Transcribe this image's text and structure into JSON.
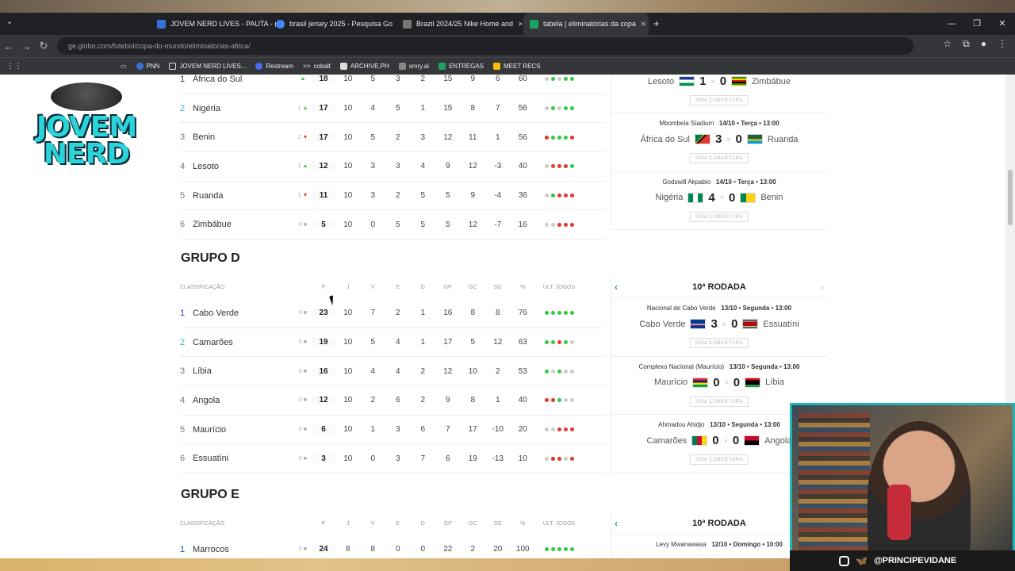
{
  "browser": {
    "tabs": [
      {
        "title": "JOVEM NERD LIVES - PAUTA - (",
        "color": "#3b6fd8"
      },
      {
        "title": "brasil jersey 2025 - Pesquisa Go",
        "color": "#4285f4"
      },
      {
        "title": "Brazil 2024/25 Nike Home and",
        "color": "#777777"
      },
      {
        "title": "tabela | eliminatórias da copa",
        "color": "#1aa260"
      }
    ],
    "url": "ge.globo.com/futebol/copa-do-mundo/eliminatorias-africa/",
    "bookmarks": [
      "PNN",
      "JOVEM NERD LIVES...",
      "Restream",
      "cobalt",
      "ARCHIVE.PH",
      "smry.ai",
      "ENTREGAS",
      "MEET RECS"
    ]
  },
  "logo": {
    "text": "JOVEM NERD"
  },
  "groupC": {
    "partial_row": {
      "pos": "1",
      "name": "África do Sul",
      "pts": "18",
      "j": "10",
      "v": "5",
      "e": "3",
      "d": "2",
      "gp": "15",
      "gc": "9",
      "sg": "6",
      "pct": "60"
    },
    "rows": [
      {
        "pos": "2",
        "name": "Nigéria",
        "trend": "1",
        "pts": "17",
        "j": "10",
        "v": "4",
        "e": "5",
        "d": "1",
        "gp": "15",
        "gc": "8",
        "sg": "7",
        "pct": "56",
        "form": [
          "#ccc",
          "#2ecc40",
          "#ccc",
          "#2ecc40",
          "#2ecc40"
        ]
      },
      {
        "pos": "3",
        "name": "Benin",
        "trend": "2",
        "pts": "17",
        "j": "10",
        "v": "5",
        "e": "2",
        "d": "3",
        "gp": "12",
        "gc": "11",
        "sg": "1",
        "pct": "56",
        "form": [
          "#e3342f",
          "#2ecc40",
          "#2ecc40",
          "#2ecc40",
          "#e3342f"
        ]
      },
      {
        "pos": "4",
        "name": "Lesoto",
        "trend": "1",
        "pts": "12",
        "j": "10",
        "v": "3",
        "e": "3",
        "d": "4",
        "gp": "9",
        "gc": "12",
        "sg": "-3",
        "pct": "40",
        "form": [
          "#ccc",
          "#e3342f",
          "#e3342f",
          "#e3342f",
          "#2ecc40"
        ]
      },
      {
        "pos": "5",
        "name": "Ruanda",
        "trend": "1",
        "pts": "11",
        "j": "10",
        "v": "3",
        "e": "2",
        "d": "5",
        "gp": "5",
        "gc": "9",
        "sg": "-4",
        "pct": "36",
        "form": [
          "#ccc",
          "#2ecc40",
          "#e3342f",
          "#e3342f",
          "#e3342f"
        ]
      },
      {
        "pos": "6",
        "name": "Zimbábue",
        "trend": "0",
        "pts": "5",
        "j": "10",
        "v": "0",
        "e": "5",
        "d": "5",
        "gp": "5",
        "gc": "12",
        "sg": "-7",
        "pct": "16",
        "form": [
          "#ccc",
          "#ccc",
          "#e3342f",
          "#e3342f",
          "#e3342f"
        ]
      }
    ],
    "games": [
      {
        "meta_venue": "",
        "meta_date": "",
        "home": "Lesoto",
        "home_score": "1",
        "away_score": "0",
        "away": "Zimbábue",
        "coverage": "SEM COBERTURA"
      },
      {
        "meta_venue": "Mbombela Stadium",
        "meta_date": "14/10 • Terça • 13:00",
        "home": "África do Sul",
        "home_score": "3",
        "away_score": "0",
        "away": "Ruanda",
        "coverage": "SEM COBERTURA"
      },
      {
        "meta_venue": "Godswill Akpabio",
        "meta_date": "14/10 • Terça • 13:00",
        "home": "Nigéria",
        "home_score": "4",
        "away_score": "0",
        "away": "Benin",
        "coverage": "SEM COBERTURA"
      }
    ]
  },
  "groupD": {
    "title": "GRUPO D",
    "headers": {
      "classificacao": "CLASSIFICAÇÃO",
      "p": "P",
      "j": "J",
      "v": "V",
      "e": "E",
      "d": "D",
      "gp": "GP",
      "gc": "GC",
      "sg": "SG",
      "pct": "%",
      "ult": "ÚLT. JOGOS"
    },
    "rows": [
      {
        "pos": "1",
        "name": "Cabo Verde",
        "trend": "0",
        "pts": "23",
        "j": "10",
        "v": "7",
        "e": "2",
        "d": "1",
        "gp": "16",
        "gc": "8",
        "sg": "8",
        "pct": "76",
        "form": [
          "#2ecc40",
          "#2ecc40",
          "#2ecc40",
          "#2ecc40",
          "#2ecc40"
        ]
      },
      {
        "pos": "2",
        "name": "Camarões",
        "trend": "0",
        "pts": "19",
        "j": "10",
        "v": "5",
        "e": "4",
        "d": "1",
        "gp": "17",
        "gc": "5",
        "sg": "12",
        "pct": "63",
        "form": [
          "#2ecc40",
          "#2ecc40",
          "#e3342f",
          "#2ecc40",
          "#ccc"
        ]
      },
      {
        "pos": "3",
        "name": "Líbia",
        "trend": "0",
        "pts": "16",
        "j": "10",
        "v": "4",
        "e": "4",
        "d": "2",
        "gp": "12",
        "gc": "10",
        "sg": "2",
        "pct": "53",
        "form": [
          "#2ecc40",
          "#ccc",
          "#2ecc40",
          "#ccc",
          "#ccc"
        ]
      },
      {
        "pos": "4",
        "name": "Angola",
        "trend": "0",
        "pts": "12",
        "j": "10",
        "v": "2",
        "e": "6",
        "d": "2",
        "gp": "9",
        "gc": "8",
        "sg": "1",
        "pct": "40",
        "form": [
          "#e3342f",
          "#e3342f",
          "#2ecc40",
          "#ccc",
          "#ccc"
        ]
      },
      {
        "pos": "5",
        "name": "Maurício",
        "trend": "0",
        "pts": "6",
        "j": "10",
        "v": "1",
        "e": "3",
        "d": "6",
        "gp": "7",
        "gc": "17",
        "sg": "-10",
        "pct": "20",
        "form": [
          "#ccc",
          "#ccc",
          "#e3342f",
          "#e3342f",
          "#e3342f"
        ]
      },
      {
        "pos": "6",
        "name": "Essuatíni",
        "trend": "0",
        "pts": "3",
        "j": "10",
        "v": "0",
        "e": "3",
        "d": "7",
        "gp": "6",
        "gc": "19",
        "sg": "-13",
        "pct": "10",
        "form": [
          "#ccc",
          "#e3342f",
          "#e3342f",
          "#ccc",
          "#e3342f"
        ]
      }
    ],
    "rodada": "10ª RODADA",
    "games": [
      {
        "meta_venue": "Nacional de Cabo Verde",
        "meta_date": "13/10 • Segunda • 13:00",
        "home": "Cabo Verde",
        "home_score": "3",
        "away_score": "0",
        "away": "Essuatíni",
        "coverage": "SEM COBERTURA"
      },
      {
        "meta_venue": "Complexo Nacional (Maurício)",
        "meta_date": "13/10 • Segunda • 13:00",
        "home": "Maurício",
        "home_score": "0",
        "away_score": "0",
        "away": "Líbia",
        "coverage": "SEM COBERTURA"
      },
      {
        "meta_venue": "Ahmadou Ahidjo",
        "meta_date": "13/10 • Segunda • 13:00",
        "home": "Camarões",
        "home_score": "0",
        "away_score": "0",
        "away": "Angola",
        "coverage": "SEM COBERTURA"
      }
    ]
  },
  "groupE": {
    "title": "GRUPO E",
    "row": {
      "pos": "1",
      "name": "Marrocos",
      "trend": "0",
      "pts": "24",
      "j": "8",
      "v": "8",
      "e": "0",
      "d": "0",
      "gp": "22",
      "gc": "2",
      "sg": "20",
      "pct": "100"
    },
    "rodada": "10ª RODADA",
    "game_meta_venue": "Levy Mwanawasa",
    "game_meta_date": "12/10 • Domingo • 10:00"
  },
  "stream": {
    "handle": "@PRINCIPEVIDANE"
  }
}
